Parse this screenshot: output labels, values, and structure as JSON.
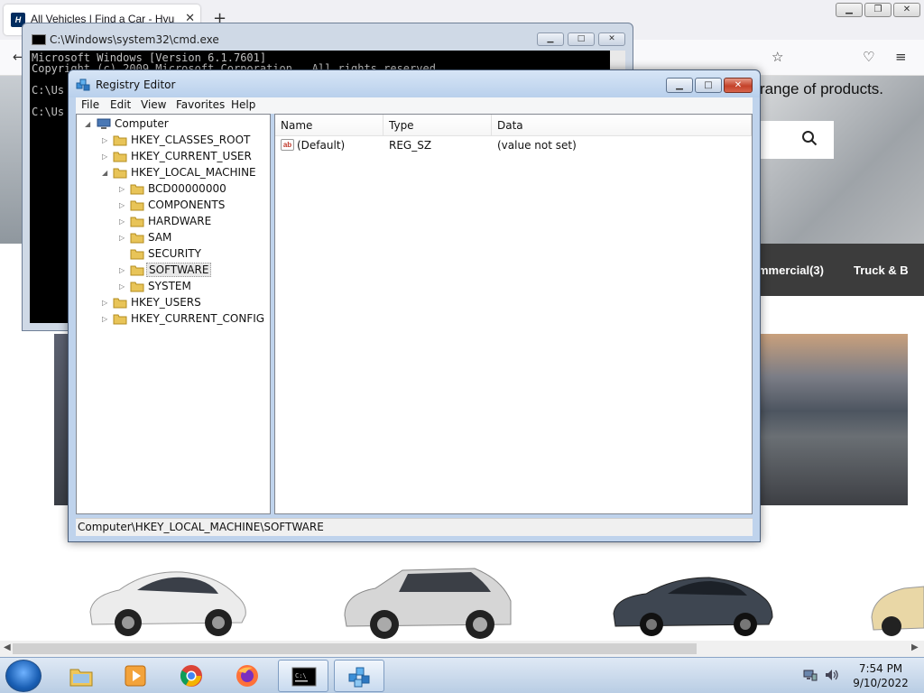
{
  "browser": {
    "tab_title": "All Vehicles | Find a Car - Hyundai",
    "tab_close": "✕",
    "new_tab": "+",
    "controls": {
      "minimize": "▁",
      "maximize": "❐",
      "close": "✕"
    },
    "hero_text": "range of products.",
    "filters": [
      "mmercial(3)",
      "Truck & B"
    ],
    "scroll_left": "◀",
    "scroll_right": "▶"
  },
  "cmd": {
    "title": "C:\\Windows\\system32\\cmd.exe",
    "lines": "Microsoft Windows [Version 6.1.7601]\nCopyright (c) 2009 Microsoft Corporation.  All rights reserved.\n\nC:\\Us\n\nC:\\Us",
    "controls": {
      "minimize": "▁",
      "maximize": "□",
      "close": "✕"
    }
  },
  "regedit": {
    "title": "Registry Editor",
    "controls": {
      "minimize": "▁",
      "maximize": "□",
      "close": "✕"
    },
    "menu": [
      "File",
      "Edit",
      "View",
      "Favorites",
      "Help"
    ],
    "tree": {
      "root": "Computer",
      "hives": [
        "HKEY_CLASSES_ROOT",
        "HKEY_CURRENT_USER",
        "HKEY_LOCAL_MACHINE"
      ],
      "hklm_children": [
        "BCD00000000",
        "COMPONENTS",
        "HARDWARE",
        "SAM",
        "SECURITY",
        "SOFTWARE",
        "SYSTEM"
      ],
      "selected": "SOFTWARE",
      "hives_after": [
        "HKEY_USERS",
        "HKEY_CURRENT_CONFIG"
      ]
    },
    "columns": [
      "Name",
      "Type",
      "Data"
    ],
    "rows": [
      {
        "name": "(Default)",
        "type": "REG_SZ",
        "data": "(value not set)",
        "icon": "ab"
      }
    ],
    "status": "Computer\\HKEY_LOCAL_MACHINE\\SOFTWARE"
  },
  "taskbar": {
    "apps": [
      "Windows Explorer",
      "Windows Media Player",
      "Google Chrome",
      "Firefox",
      "Command Prompt",
      "Registry Editor"
    ],
    "time": "7:54 PM",
    "date": "9/10/2022"
  },
  "colors": {
    "accent": "#1a5fb4",
    "close_red": "#c4422a",
    "filter_bar": "#3c3c3c"
  }
}
